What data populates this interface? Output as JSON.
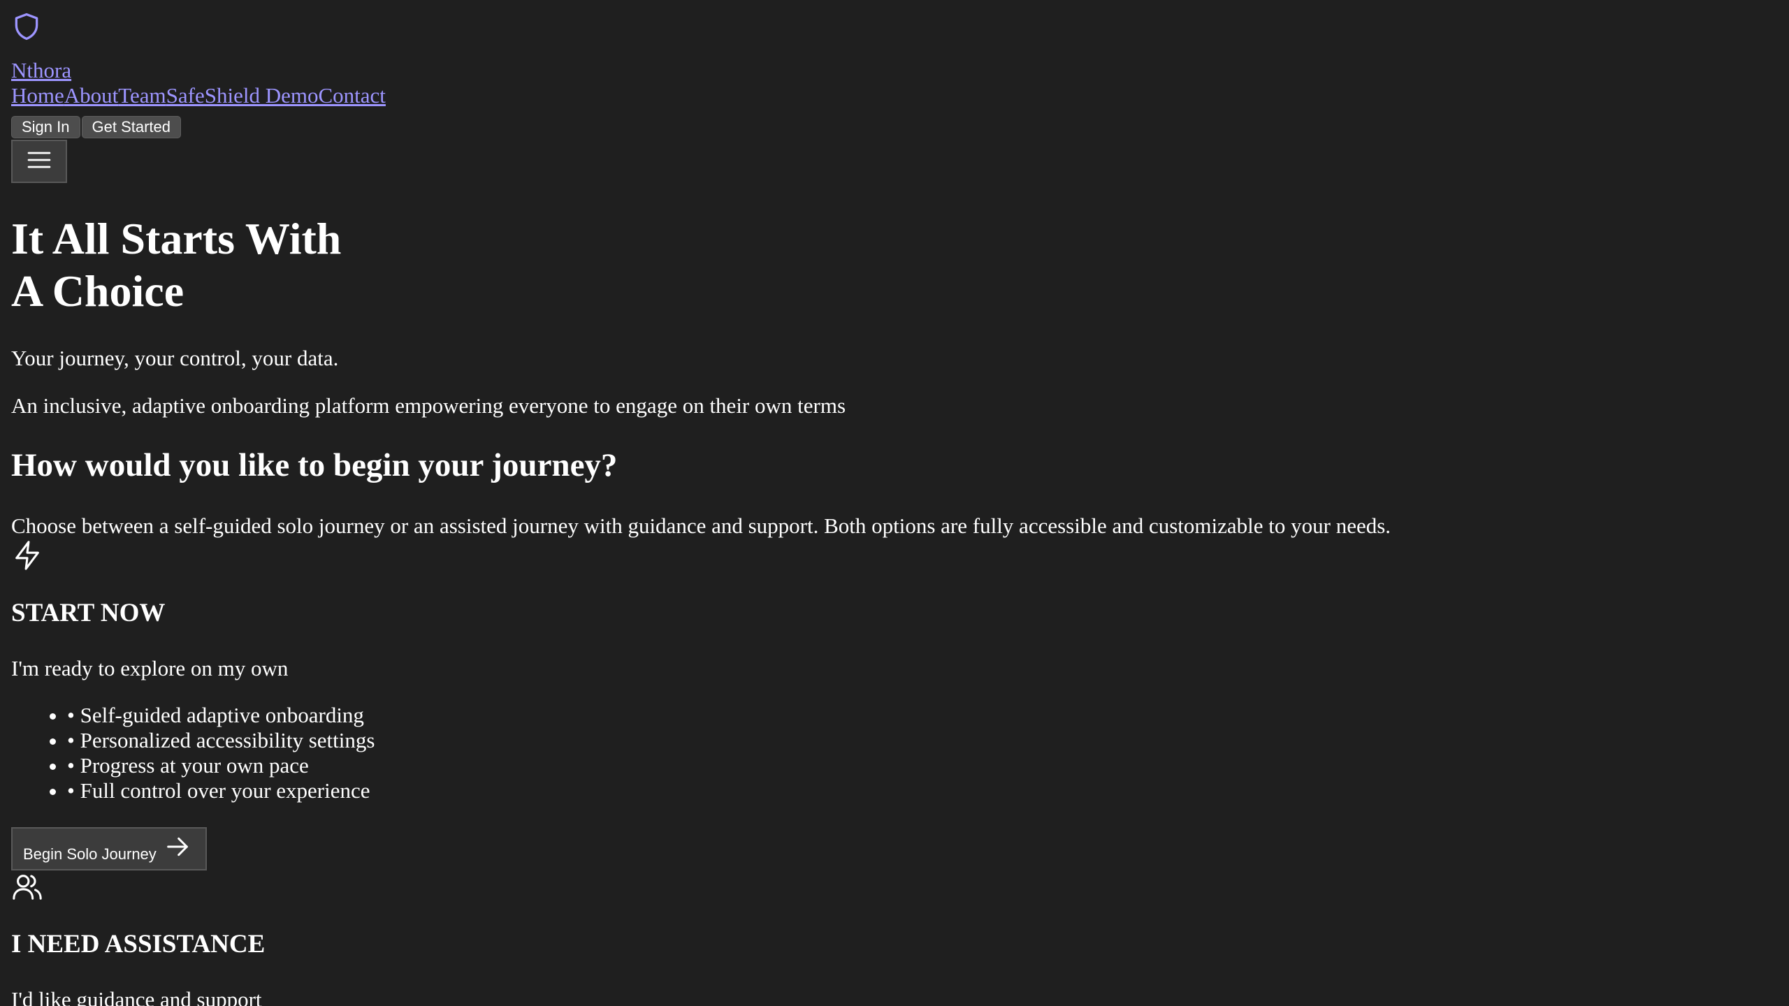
{
  "header": {
    "logo_icon": "shield-icon",
    "brand": "Nthora",
    "nav": [
      "Home",
      "About",
      "Team",
      "SafeShield Demo",
      "Contact"
    ],
    "sign_in": "Sign In",
    "get_started": "Get Started",
    "menu_icon": "hamburger-menu-icon"
  },
  "hero": {
    "title": "It All Starts With\nA Choice",
    "tagline": "Your journey, your control, your data.",
    "subtitle": "An inclusive, adaptive onboarding platform empowering everyone to engage on their own terms"
  },
  "choice": {
    "heading": "How would you like to begin your journey?",
    "description": "Choose between a self-guided solo journey or an assisted journey with guidance and support. Both options are fully accessible and customizable to your needs."
  },
  "solo": {
    "icon": "lightning-icon",
    "title": "START NOW",
    "subtitle": "I'm ready to explore on my own",
    "features": [
      "• Self-guided adaptive onboarding",
      "• Personalized accessibility settings",
      "• Progress at your own pace",
      "• Full control over your experience"
    ],
    "button": "Begin Solo Journey",
    "button_icon": "arrow-right-icon"
  },
  "assisted": {
    "icon": "users-icon",
    "title": "I NEED ASSISTANCE",
    "subtitle": "I'd like guidance and support"
  },
  "colors": {
    "background": "#1f1f1f",
    "link": "#9d95ff",
    "button": "#4d4d4d"
  }
}
